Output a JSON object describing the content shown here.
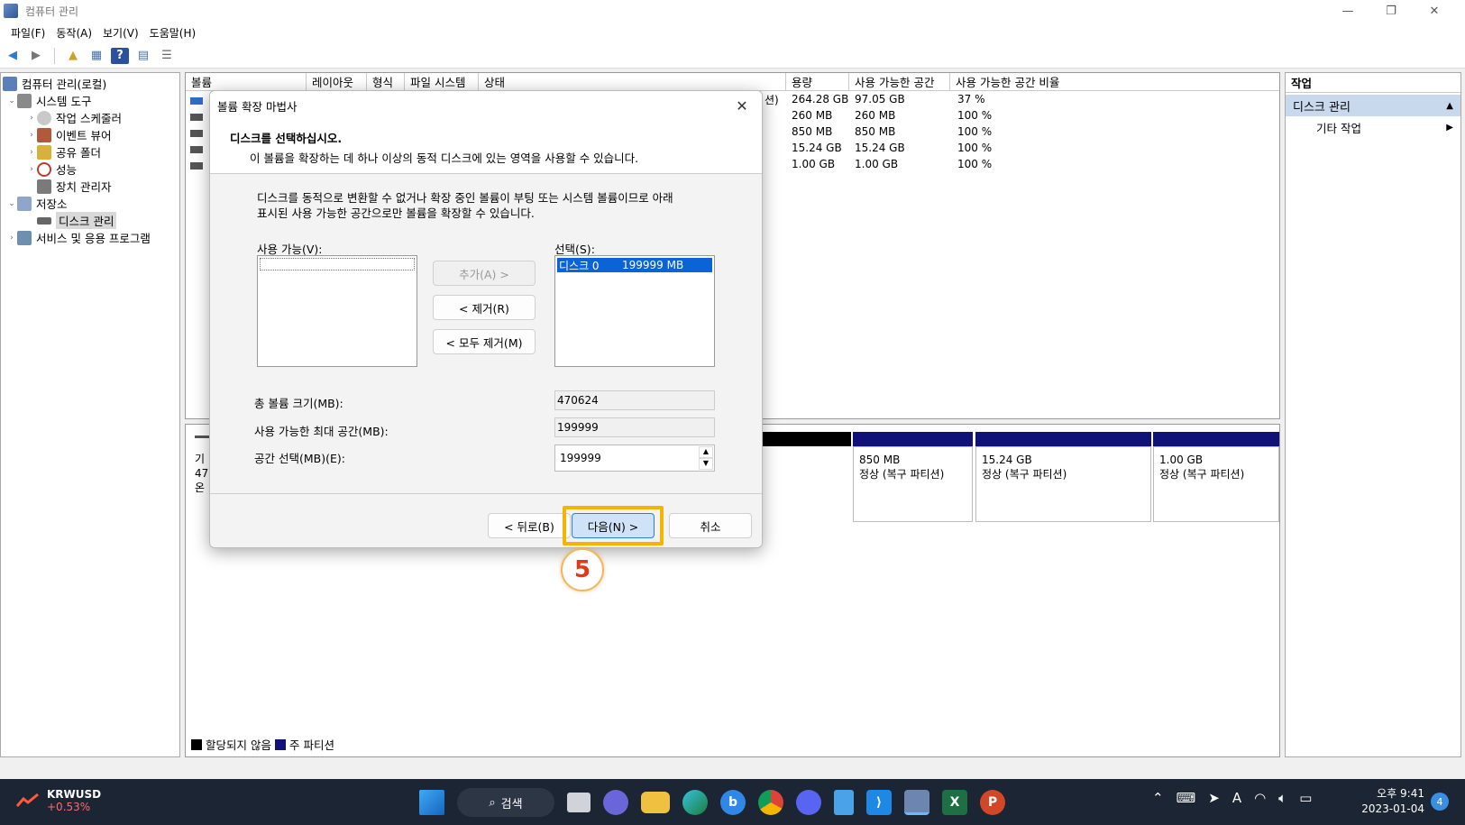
{
  "window": {
    "title": "컴퓨터 관리"
  },
  "menu": [
    "파일(F)",
    "동작(A)",
    "보기(V)",
    "도움말(H)"
  ],
  "tree": {
    "items": [
      {
        "label": "컴퓨터 관리(로컬)"
      },
      {
        "label": "시스템 도구"
      },
      {
        "label": "작업 스케줄러"
      },
      {
        "label": "이벤트 뷰어"
      },
      {
        "label": "공유 폴더"
      },
      {
        "label": "성능"
      },
      {
        "label": "장치 관리자"
      },
      {
        "label": "저장소"
      },
      {
        "label": "디스크 관리"
      },
      {
        "label": "서비스 및 응용 프로그램"
      }
    ]
  },
  "volumes": {
    "columns": [
      "볼륨",
      "레이아웃",
      "형식",
      "파일 시스템",
      "상태",
      "용량",
      "사용 가능한 공간",
      "사용 가능한 공간 비율"
    ],
    "status_fragment": "션)",
    "rows": [
      {
        "capacity": "264.28 GB",
        "free": "97.05 GB",
        "pct": "37 %"
      },
      {
        "capacity": "260 MB",
        "free": "260 MB",
        "pct": "100 %"
      },
      {
        "capacity": "850 MB",
        "free": "850 MB",
        "pct": "100 %"
      },
      {
        "capacity": "15.24 GB",
        "free": "15.24 GB",
        "pct": "100 %"
      },
      {
        "capacity": "1.00 GB",
        "free": "1.00 GB",
        "pct": "100 %"
      }
    ]
  },
  "disk_graph": {
    "left_frag": [
      "기",
      "47",
      "온"
    ],
    "partitions": [
      {
        "size": "850 MB",
        "status": "정상 (복구 파티션)"
      },
      {
        "size": "15.24 GB",
        "status": "정상 (복구 파티션)"
      },
      {
        "size": "1.00 GB",
        "status": "정상 (복구 파티션)"
      }
    ],
    "legend": {
      "unallocated": "할당되지 않음",
      "primary": "주 파티션"
    }
  },
  "actions": {
    "header": "작업",
    "selected": "디스크 관리",
    "item": "기타 작업"
  },
  "dialog": {
    "title": "볼륨 확장 마법사",
    "heading": "디스크를 선택하십시오.",
    "subheading": "이 볼륨을 확장하는 데 하나 이상의 동적 디스크에 있는 영역을 사용할 수 있습니다.",
    "description_line1": "디스크를 동적으로 변환할 수 없거나 확장 중인 볼륨이 부팅 또는 시스템 볼륨이므로 아래",
    "description_line2": "표시된 사용 가능한 공간으로만 볼륨을 확장할 수 있습니다.",
    "available_label": "사용 가능(V):",
    "selected_label": "선택(S):",
    "selected_item_disk": "디스크 0",
    "selected_item_size": "199999 MB",
    "add_button": "추가(A) >",
    "remove_button": "< 제거(R)",
    "remove_all_button": "< 모두 제거(M)",
    "total_label": "총 볼륨 크기(MB):",
    "total_value": "470624",
    "max_label": "사용 가능한 최대 공간(MB):",
    "max_value": "199999",
    "select_label": "공간 선택(MB)(E):",
    "select_value": "199999",
    "back_button": "< 뒤로(B)",
    "next_button": "다음(N) >",
    "cancel_button": "취소"
  },
  "annotation": {
    "step": "5"
  },
  "taskbar": {
    "ticker_name": "KRWUSD",
    "ticker_change": "+0.53%",
    "search": "검색",
    "time": "오후 9:41",
    "date": "2023-01-04",
    "notification_count": "4"
  }
}
